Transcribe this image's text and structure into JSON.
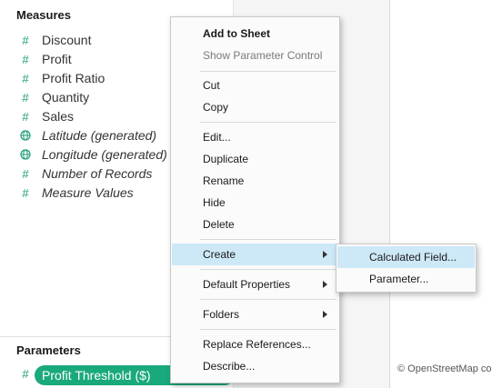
{
  "measures": {
    "header": "Measures",
    "items": [
      {
        "label": "Discount",
        "icon": "hash-icon",
        "italic": false
      },
      {
        "label": "Profit",
        "icon": "hash-icon",
        "italic": false
      },
      {
        "label": "Profit Ratio",
        "icon": "hash-icon",
        "italic": false
      },
      {
        "label": "Quantity",
        "icon": "hash-icon",
        "italic": false
      },
      {
        "label": "Sales",
        "icon": "hash-icon",
        "italic": false
      },
      {
        "label": "Latitude (generated)",
        "icon": "globe-icon",
        "italic": true
      },
      {
        "label": "Longitude (generated)",
        "icon": "globe-icon",
        "italic": true
      },
      {
        "label": "Number of Records",
        "icon": "hash-icon",
        "italic": true
      },
      {
        "label": "Measure Values",
        "icon": "hash-icon",
        "italic": true
      }
    ]
  },
  "parameters": {
    "header": "Parameters",
    "pill_label": "Profit Threshold ($)"
  },
  "context_menu": {
    "add_to_sheet": "Add to Sheet",
    "show_parameter_control": "Show Parameter Control",
    "cut": "Cut",
    "copy": "Copy",
    "edit": "Edit...",
    "duplicate": "Duplicate",
    "rename": "Rename",
    "hide": "Hide",
    "delete": "Delete",
    "create": "Create",
    "default_properties": "Default Properties",
    "folders": "Folders",
    "replace_references": "Replace References...",
    "describe": "Describe..."
  },
  "submenu": {
    "calculated_field": "Calculated Field...",
    "parameter": "Parameter..."
  },
  "map": {
    "credit": "© OpenStreetMap co"
  },
  "colors": {
    "accent_green": "#1aa97c",
    "menu_highlight": "#cde8f7"
  }
}
